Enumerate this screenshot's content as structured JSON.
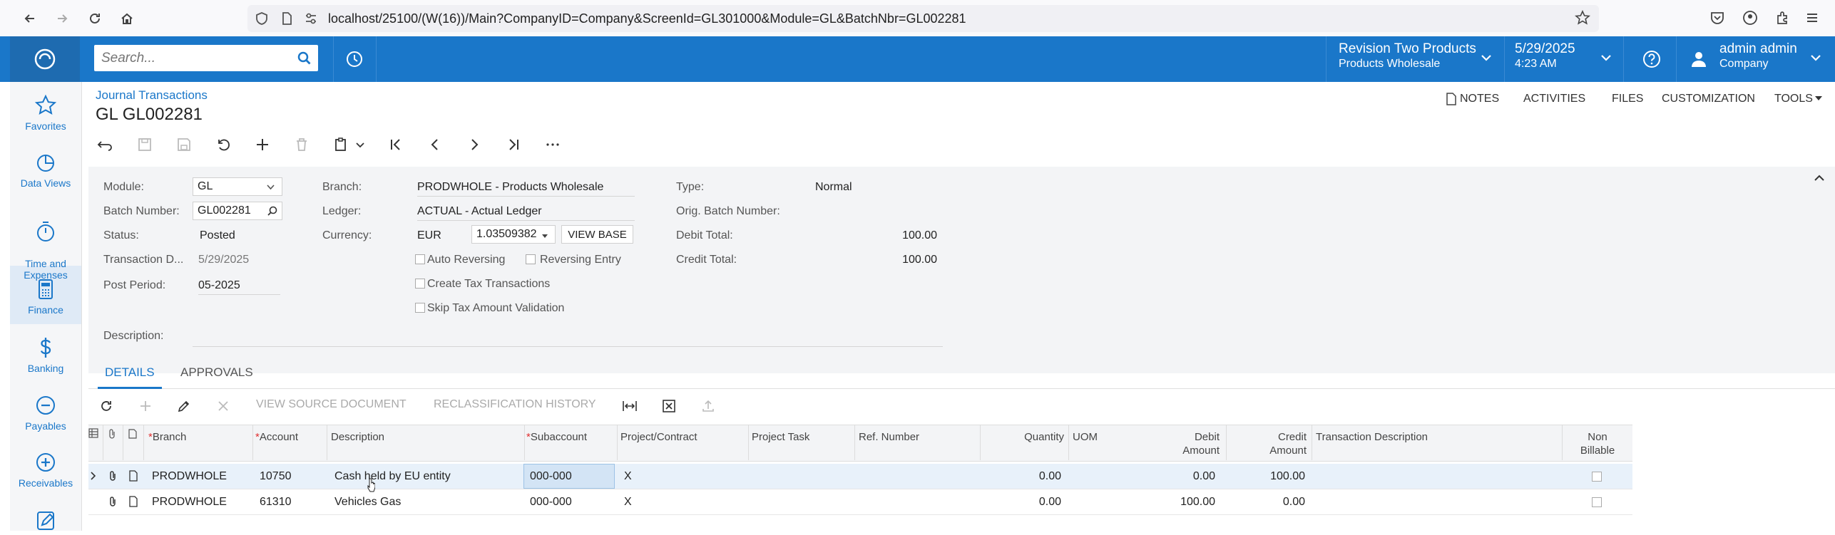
{
  "browser": {
    "url": "localhost/25100/(W(16))/Main?CompanyID=Company&ScreenId=GL301000&Module=GL&BatchNbr=GL002281"
  },
  "topbar": {
    "search_placeholder": "Search...",
    "tenant_name": "Revision Two Products",
    "tenant_branch": "Products Wholesale",
    "date": "5/29/2025",
    "time": "4:23 AM",
    "user_name": "admin admin",
    "user_company": "Company"
  },
  "nav": {
    "items": [
      {
        "label": "Favorites",
        "icon": "star-icon"
      },
      {
        "label": "Data Views",
        "icon": "pie-chart-icon"
      },
      {
        "label": "Time and\nExpenses",
        "icon": "stopwatch-icon"
      },
      {
        "label": "Finance",
        "icon": "calculator-icon"
      },
      {
        "label": "Banking",
        "icon": "dollar-icon"
      },
      {
        "label": "Payables",
        "icon": "minus-circle-icon"
      },
      {
        "label": "Receivables",
        "icon": "plus-circle-icon"
      },
      {
        "label": "",
        "icon": "pencil-icon"
      }
    ]
  },
  "page": {
    "breadcrumb": "Journal Transactions",
    "title": "GL GL002281",
    "header_links": [
      "NOTES",
      "ACTIVITIES",
      "FILES",
      "CUSTOMIZATION",
      "TOOLS"
    ]
  },
  "form": {
    "module_label": "Module:",
    "module_value": "GL",
    "batch_label": "Batch Number:",
    "batch_value": "GL002281",
    "status_label": "Status:",
    "status_value": "Posted",
    "trandate_label": "Transaction D...",
    "trandate_value": "5/29/2025",
    "period_label": "Post Period:",
    "period_value": "05-2025",
    "description_label": "Description:",
    "branch_label": "Branch:",
    "branch_value": "PRODWHOLE - Products Wholesale",
    "ledger_label": "Ledger:",
    "ledger_value": "ACTUAL - Actual Ledger",
    "currency_label": "Currency:",
    "currency_value": "EUR",
    "rate_value": "1.03509382",
    "view_base": "VIEW BASE",
    "auto_reversing": "Auto Reversing",
    "reversing_entry": "Reversing Entry",
    "create_tax": "Create Tax Transactions",
    "skip_tax": "Skip Tax Amount Validation",
    "type_label": "Type:",
    "type_value": "Normal",
    "orig_batch_label": "Orig. Batch Number:",
    "debit_total_label": "Debit Total:",
    "debit_total_value": "100.00",
    "credit_total_label": "Credit Total:",
    "credit_total_value": "100.00"
  },
  "tabs": [
    "DETAILS",
    "APPROVALS"
  ],
  "grid_toolbar": {
    "view_source": "VIEW SOURCE DOCUMENT",
    "reclass_history": "RECLASSIFICATION HISTORY"
  },
  "grid": {
    "columns": {
      "branch": "Branch",
      "account": "Account",
      "description": "Description",
      "subaccount": "Subaccount",
      "project": "Project/Contract",
      "task": "Project Task",
      "ref": "Ref. Number",
      "qty": "Quantity",
      "uom": "UOM",
      "debit1": "Debit",
      "debit2": "Amount",
      "credit1": "Credit",
      "credit2": "Amount",
      "trandesc": "Transaction Description",
      "nonbill1": "Non",
      "nonbill2": "Billable"
    },
    "rows": [
      {
        "branch": "PRODWHOLE",
        "account": "10750",
        "description": "Cash held by EU entity",
        "subaccount": "000-000",
        "project": "X",
        "qty": "0.00",
        "debit": "0.00",
        "credit": "100.00"
      },
      {
        "branch": "PRODWHOLE",
        "account": "61310",
        "description": "Vehicles Gas",
        "subaccount": "000-000",
        "project": "X",
        "qty": "0.00",
        "debit": "100.00",
        "credit": "0.00"
      }
    ]
  }
}
